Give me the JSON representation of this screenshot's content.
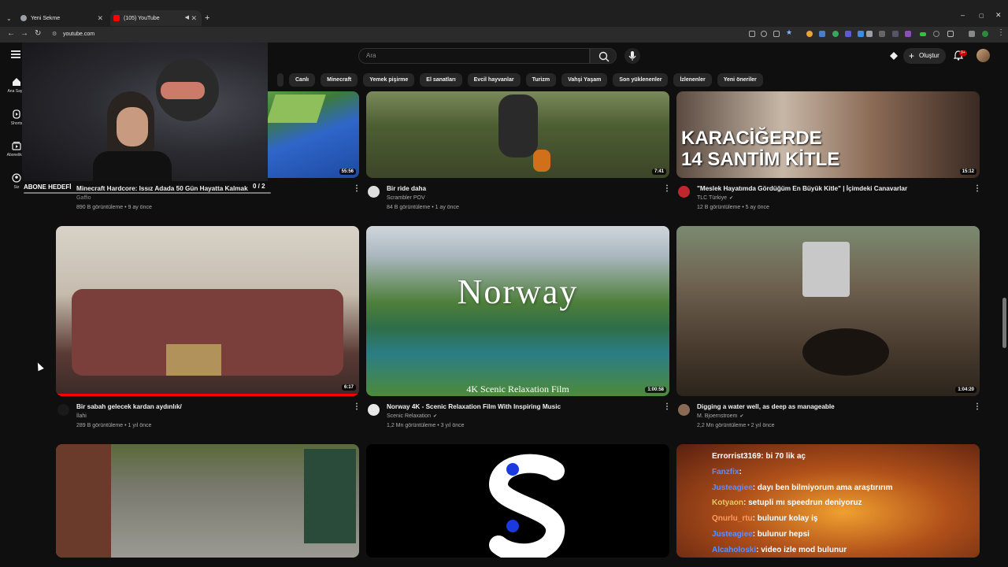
{
  "browser": {
    "tabs": [
      {
        "title": "Yeni Sekme",
        "active": false
      },
      {
        "title": "(105) YouTube",
        "active": true
      }
    ],
    "url": "youtube.com"
  },
  "header": {
    "search_placeholder": "Ara",
    "create_label": "Oluştur",
    "notification_count": "9+"
  },
  "chips": [
    "Canlı",
    "Minecraft",
    "Yemek pişirme",
    "El sanatları",
    "Evcil hayvanlar",
    "Turizm",
    "Vahşi Yaşam",
    "Son yüklenenler",
    "İzlenenler",
    "Yeni öneriler"
  ],
  "sidebar": [
    {
      "label": "Ana Sayfa",
      "icon": "home-icon"
    },
    {
      "label": "Shorts",
      "icon": "shorts-icon"
    },
    {
      "label": "Abonelikler",
      "icon": "subscriptions-icon"
    },
    {
      "label": "Siz",
      "icon": "you-icon"
    }
  ],
  "overlay": {
    "goal_label": "ABONE HEDEFİ",
    "goal_count": "0 / 2"
  },
  "videos": [
    {
      "title": "Minecraft Hardcore: Issız Adada 50 Gün Hayatta Kalmak",
      "channel": "Gaffio",
      "meta": "890 B görüntüleme • 9 ay önce",
      "duration": "55:56"
    },
    {
      "title": "Bir ride daha",
      "channel": "Scrambler POV",
      "meta": "84 B görüntüleme • 1 ay önce",
      "duration": "7:41"
    },
    {
      "title": "\"Meslek Hayatımda Gördüğüm En Büyük Kitle\" | İçimdeki Canavarlar",
      "channel": "TLC Türkiye",
      "meta": "12 B görüntüleme • 5 ay önce",
      "duration": "15:12",
      "thumb_text": [
        "KARACİĞERDE",
        "14 SANTİM KİTLE"
      ]
    },
    {
      "title": "Bir sabah gelecek kardan aydınlık/",
      "channel": "İlahi",
      "meta": "289 B görüntüleme • 1 yıl önce",
      "duration": "6:17"
    },
    {
      "title": "Norway 4K - Scenic Relaxation Film With Inspiring Music",
      "channel": "Scenic Relaxation",
      "meta": "1,2 Mn görüntüleme • 3 yıl önce",
      "duration": "1:00:58",
      "thumb_text": [
        "Norway",
        "4K Scenic Relaxation Film"
      ]
    },
    {
      "title": "Digging a water well,  as deep as manageable",
      "channel": "M. Bjoernstroem",
      "meta": "2,2 Mn görüntüleme • 2 yıl önce",
      "duration": "1:04:20"
    }
  ],
  "chat": [
    {
      "user": "Errorrist3169",
      "msg": ": bi 70 lik aç"
    },
    {
      "user": "Fanzfix",
      "msg": ":"
    },
    {
      "user": "Justeagiee",
      "msg": ": dayı ben bilmiyorum ama araştırırım"
    },
    {
      "user": "Kotyaon",
      "msg": ": setupli mı speedrun deniyoruz"
    },
    {
      "user": "Qnurlu_rtu",
      "msg": ": bulunur kolay iş"
    },
    {
      "user": "Justeagiee",
      "msg": ": bulunur hepsi"
    },
    {
      "user": "Alcaholoski",
      "msg": ": video izle mod bulunur"
    }
  ],
  "colors": {
    "background": "#0f0f0f",
    "chip": "#272727",
    "accent_red": "#cc0000"
  }
}
